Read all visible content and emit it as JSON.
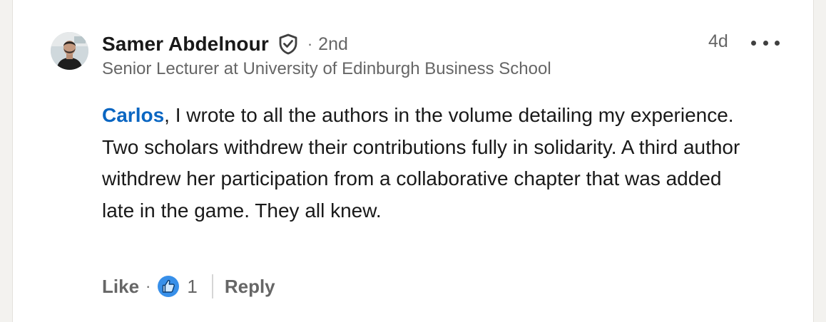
{
  "comment": {
    "author": {
      "name": "Samer Abdelnour",
      "connection": "2nd",
      "headline": "Senior Lecturer at University of Edinburgh Business School",
      "verified_icon": "shield-check-icon",
      "avatar_icon": "profile-photo"
    },
    "time_ago": "4d",
    "more_icon": "ellipsis-icon",
    "mention": "Carlos",
    "text": ", I wrote to all the authors in the volume detailing my experience. Two scholars withdrew their contributions fully in solidarity. A third author withdrew her participation from a collaborative chapter that was added late in the game. They all knew.",
    "actions": {
      "like_label": "Like",
      "separator": "·",
      "reaction_icon": "thumbs-up-icon",
      "reaction_count": "1",
      "reply_label": "Reply"
    }
  },
  "colors": {
    "link": "#0a66c2",
    "muted": "#666666",
    "text": "#191919",
    "like_badge": "#378fe9"
  }
}
